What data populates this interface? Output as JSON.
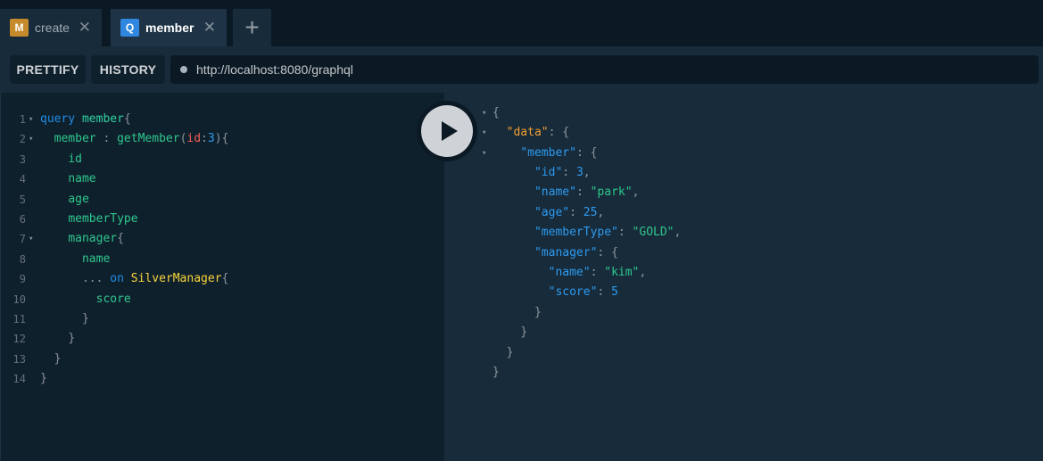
{
  "tabs": [
    {
      "badge": "M",
      "label": "create",
      "badge_color": "#c48a2c",
      "active": false
    },
    {
      "badge": "Q",
      "label": "member",
      "badge_color": "#2f87e0",
      "active": true
    }
  ],
  "tab_add_label": "+",
  "tab_close_glyph": "✕",
  "toolbar": {
    "prettify_label": "PRETTIFY",
    "history_label": "HISTORY",
    "url": "http://localhost:8080/graphql"
  },
  "query": {
    "line_numbers": [
      "1",
      "2",
      "3",
      "4",
      "5",
      "6",
      "7",
      "8",
      "9",
      "10",
      "11",
      "12",
      "13",
      "14"
    ]
  },
  "response": {
    "data_key": "\"data\"",
    "member_key": "\"member\"",
    "id_key": "\"id\"",
    "id_value": "3",
    "name_key": "\"name\"",
    "name_value": "\"park\"",
    "age_key": "\"age\"",
    "age_value": "25",
    "memberType_key": "\"memberType\"",
    "memberType_value": "\"GOLD\"",
    "manager_key": "\"manager\"",
    "manager_name_key": "\"name\"",
    "manager_name_value": "\"kim\"",
    "score_key": "\"score\"",
    "score_value": "5"
  },
  "colors": {
    "accent_blue": "#1f8ce4",
    "accent_green": "#2ec78c",
    "accent_orange": "#f29c2f",
    "accent_yellow": "#f8d43a",
    "accent_red": "#f25c54"
  },
  "icons": {
    "play": "play-icon",
    "url_status": "status-dot-icon"
  }
}
